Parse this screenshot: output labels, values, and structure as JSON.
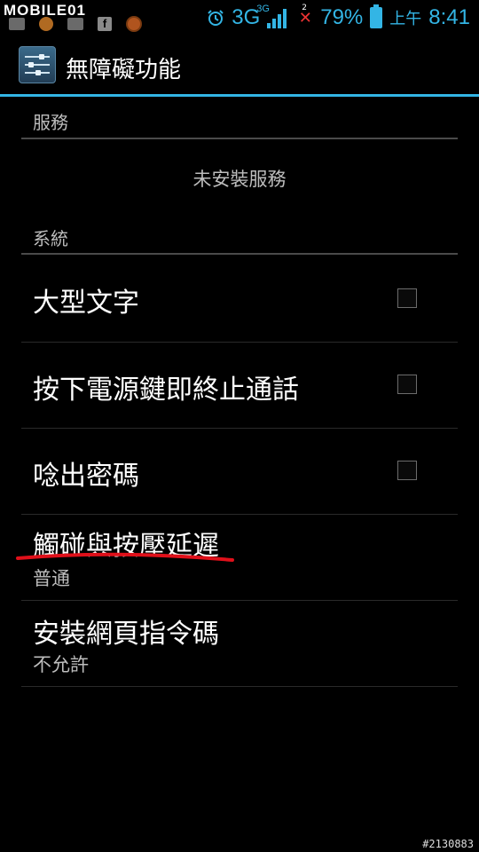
{
  "status_bar": {
    "watermark": "MOBILE01",
    "left_icons": [
      "image-icon",
      "app-icon",
      "message-icon",
      "facebook-icon",
      "power-icon"
    ],
    "facebook_glyph": "f",
    "network": "3G",
    "network_sup": "3G",
    "notification_count": "2",
    "battery": "79%",
    "ampm": "上午",
    "time": "8:41",
    "accent": "#33b5e5"
  },
  "action_bar": {
    "title": "無障礙功能",
    "icon": "settings-sliders-icon"
  },
  "sections": {
    "services": {
      "header": "服務",
      "empty_text": "未安裝服務"
    },
    "system": {
      "header": "系統",
      "items": [
        {
          "title": "大型文字",
          "checked": false
        },
        {
          "title": "按下電源鍵即終止通話",
          "checked": false
        },
        {
          "title": "唸出密碼",
          "checked": false
        },
        {
          "title": "觸碰與按壓延遲",
          "summary": "普通"
        },
        {
          "title": "安裝網頁指令碼",
          "summary": "不允許"
        }
      ]
    }
  },
  "footer_id": "#2130883",
  "annotation_color": "#e0101a"
}
